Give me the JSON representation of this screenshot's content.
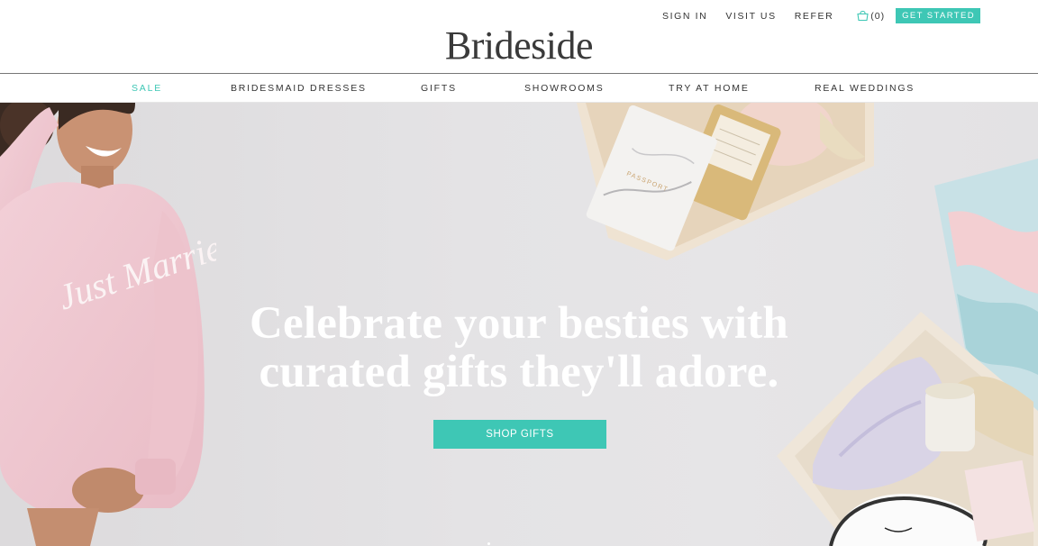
{
  "header": {
    "logo": "Brideside",
    "util_links": {
      "sign_in": "SIGN IN",
      "visit_us": "VISIT US",
      "refer": "REFER",
      "cart": "(0)",
      "get_started": "GET STARTED"
    }
  },
  "nav": {
    "items": [
      {
        "label": "SALE",
        "highlight": true
      },
      {
        "label": "BRIDESMAID DRESSES"
      },
      {
        "label": "GIFTS"
      },
      {
        "label": "SHOWROOMS"
      },
      {
        "label": "TRY AT HOME"
      },
      {
        "label": "REAL WEDDINGS"
      }
    ]
  },
  "hero": {
    "title_line1": "Celebrate your besties with",
    "title_line2": "curated gifts they'll adore.",
    "cta": "SHOP GIFTS",
    "sweatshirt_text": "Just Married",
    "passport_text": "PASSPORT"
  },
  "colors": {
    "accent": "#3ec7b5",
    "hero_bg": "#e4e3e5",
    "text": "#333333"
  },
  "icons": [
    "cart-icon"
  ]
}
